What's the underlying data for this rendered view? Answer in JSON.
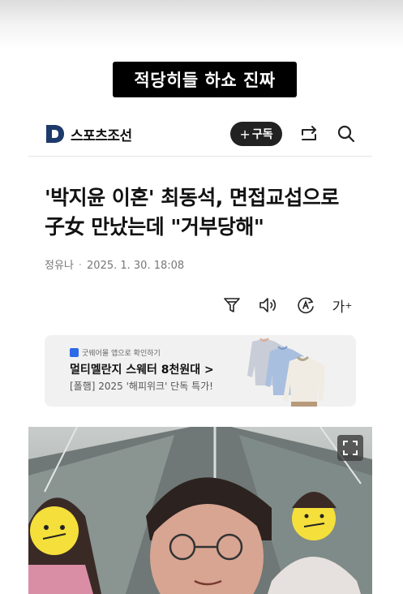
{
  "story": {
    "caption": "적당히들 하쇼 진짜"
  },
  "site": {
    "name": "스포츠조선",
    "subscribe_label": "구독",
    "subscribe_plus": "+",
    "icons": [
      "share-icon",
      "search-icon"
    ]
  },
  "article": {
    "headline": "'박지윤 이혼' 최동석, 면접교섭으로 子女 만났는데 \"거부당해\"",
    "author": "정유나",
    "separator": "·",
    "date": "2025. 1. 30. 18:08",
    "tools": [
      "summary-filter-icon",
      "listen-audio-icon",
      "translate-icon",
      "font-size-icon"
    ],
    "font_size_label": "가"
  },
  "ad": {
    "source": "굿웨어몰 앱으로 확인하기",
    "title": "멀티멜란지 스웨터 8천원대 >",
    "subtitle": "[폴햄] 2025 '해피위크' 단독 특가!"
  },
  "photo": {
    "description_icon": "expand-icon"
  },
  "colors": {
    "logo": "#1d3a6b",
    "subscribe_bg": "#222222",
    "ad_bg": "#f1f1f1",
    "ad_app_icon": "#2d6ae8"
  }
}
